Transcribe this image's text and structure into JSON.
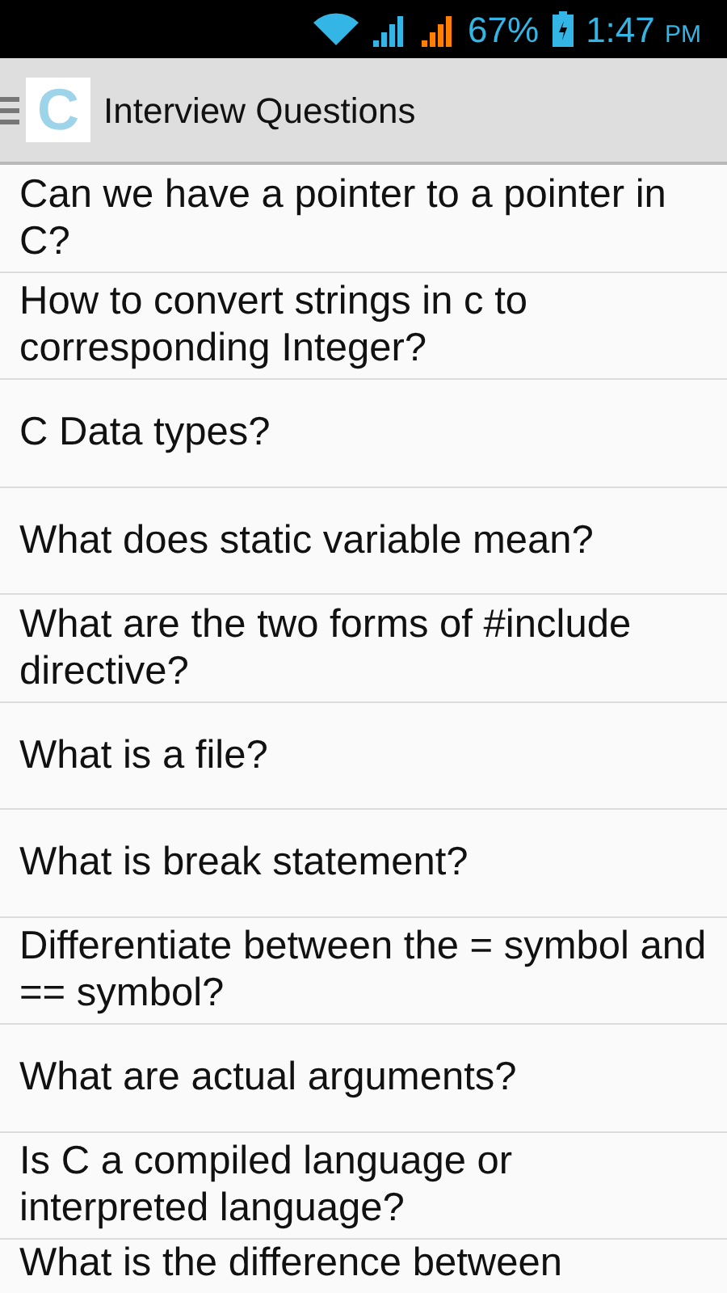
{
  "status_bar": {
    "battery": "67%",
    "time": "1:47",
    "ampm": "PM"
  },
  "action_bar": {
    "title": "Interview Questions",
    "logo": "C"
  },
  "questions": [
    {
      "text": "Can we have a pointer to a pointer in C?"
    },
    {
      "text": "How to convert strings in c to corresponding Integer?"
    },
    {
      "text": "C Data types?"
    },
    {
      "text": "What does static variable mean?"
    },
    {
      "text": "What are the two forms of #include directive?"
    },
    {
      "text": "What is a file?"
    },
    {
      "text": "What is break statement?"
    },
    {
      "text": "Differentiate between the = symbol and == symbol?"
    },
    {
      "text": "What are actual arguments?"
    },
    {
      "text": "Is C a compiled language or interpreted language?"
    },
    {
      "text": "What is the difference between"
    }
  ]
}
